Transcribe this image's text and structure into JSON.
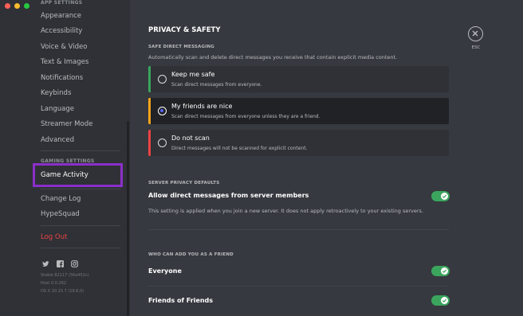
{
  "sidebar": {
    "app_settings_header": "APP SETTINGS",
    "items": [
      "Appearance",
      "Accessibility",
      "Voice & Video",
      "Text & Images",
      "Notifications",
      "Keybinds",
      "Language",
      "Streamer Mode",
      "Advanced"
    ],
    "gaming_settings_header": "GAMING SETTINGS",
    "game_activity": "Game Activity",
    "change_log": "Change Log",
    "hypesquad": "HypeSquad",
    "log_out": "Log Out",
    "version_lines": [
      "Stable 82117 (56a452c)",
      "Host 0.0.262",
      "OS X 10.15.7 (19.6.0)"
    ],
    "social_icons": [
      "twitter-icon",
      "facebook-icon",
      "instagram-icon"
    ]
  },
  "main": {
    "title": "PRIVACY & SAFETY",
    "safe_dm": {
      "header": "SAFE DIRECT MESSAGING",
      "description": "Automatically scan and delete direct messages you receive that contain explicit media content.",
      "options": [
        {
          "title": "Keep me safe",
          "desc": "Scan direct messages from everyone.",
          "selected": false,
          "accent": "#3ba55d"
        },
        {
          "title": "My friends are nice",
          "desc": "Scan direct messages from everyone unless they are a friend.",
          "selected": true,
          "accent": "#faa61a"
        },
        {
          "title": "Do not scan",
          "desc": "Direct messages will not be scanned for explicit content.",
          "selected": false,
          "accent": "#ed4245"
        }
      ]
    },
    "server_privacy": {
      "header": "SERVER PRIVACY DEFAULTS",
      "label": "Allow direct messages from server members",
      "note": "This setting is applied when you join a new server. It does not apply retroactively to your existing servers.",
      "enabled": true
    },
    "friend_requests": {
      "header": "WHO CAN ADD YOU AS A FRIEND",
      "everyone": "Everyone",
      "everyone_enabled": true,
      "friends_of_friends": "Friends of Friends",
      "friends_of_friends_enabled": true
    },
    "esc_label": "ESC"
  },
  "colors": {
    "toggle_on": "#3ba55d",
    "highlight_box": "#8b2fc9",
    "logout": "#ed4245",
    "radio_selected": "#5865f2"
  }
}
